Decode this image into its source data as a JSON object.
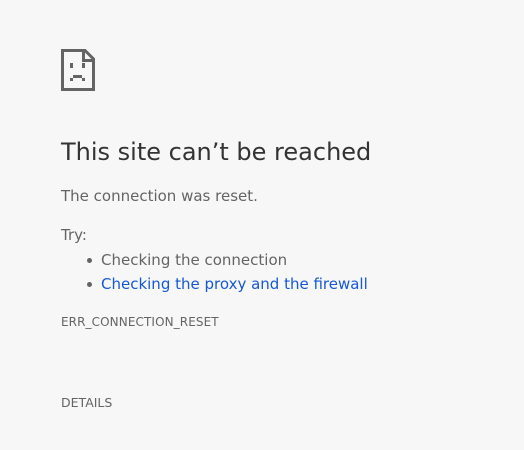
{
  "icon": {
    "name": "sad-document-icon",
    "color": "#646464"
  },
  "error": {
    "title": "This site can’t be reached",
    "summary": "The connection was reset.",
    "try_label": "Try:",
    "suggestions": [
      {
        "text": "Checking the connection",
        "is_link": false
      },
      {
        "text": "Checking the proxy and the firewall",
        "is_link": true
      }
    ],
    "code": "ERR_CONNECTION_RESET",
    "details_label": "DETAILS"
  },
  "colors": {
    "background": "#f7f7f7",
    "title": "#333333",
    "body_text": "#646464",
    "link": "#1558d6"
  }
}
